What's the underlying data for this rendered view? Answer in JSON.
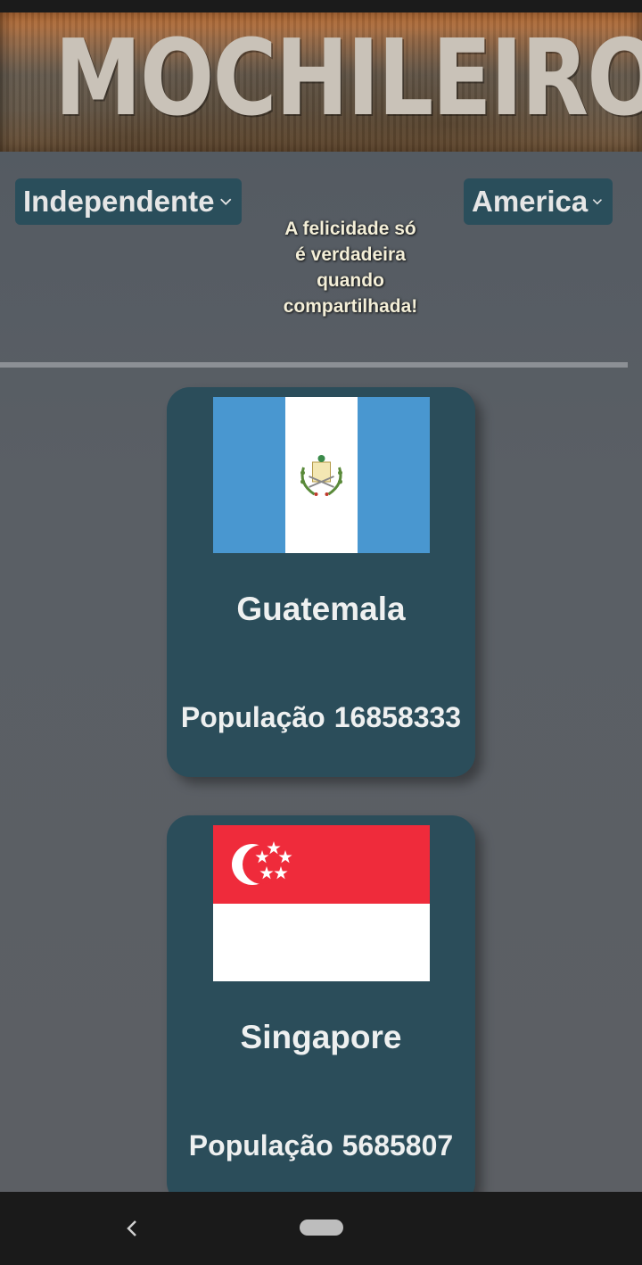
{
  "header": {
    "logo_text": "MOCHILEIROS"
  },
  "filters": {
    "status": {
      "selected": "Independente"
    },
    "region": {
      "selected": "America"
    }
  },
  "quote": {
    "lines": [
      "A felicidade só",
      "é verdadeira",
      "quando",
      "compartilhada!"
    ]
  },
  "countries": [
    {
      "name": "Guatemala",
      "population_label": "População",
      "population": "16858333",
      "flag": "guatemala-flag"
    },
    {
      "name": "Singapore",
      "population_label": "População",
      "population": "5685807",
      "flag": "singapore-flag"
    }
  ],
  "colors": {
    "card": "#2b4d5a",
    "dropdown": "#2a4e5b",
    "background": "#5a5e63",
    "guatemala_blue": "#4997d0",
    "singapore_red": "#ef2b3b"
  },
  "navigation": {
    "back_icon": "chevron-left-icon",
    "home_icon": "home-pill-icon"
  }
}
